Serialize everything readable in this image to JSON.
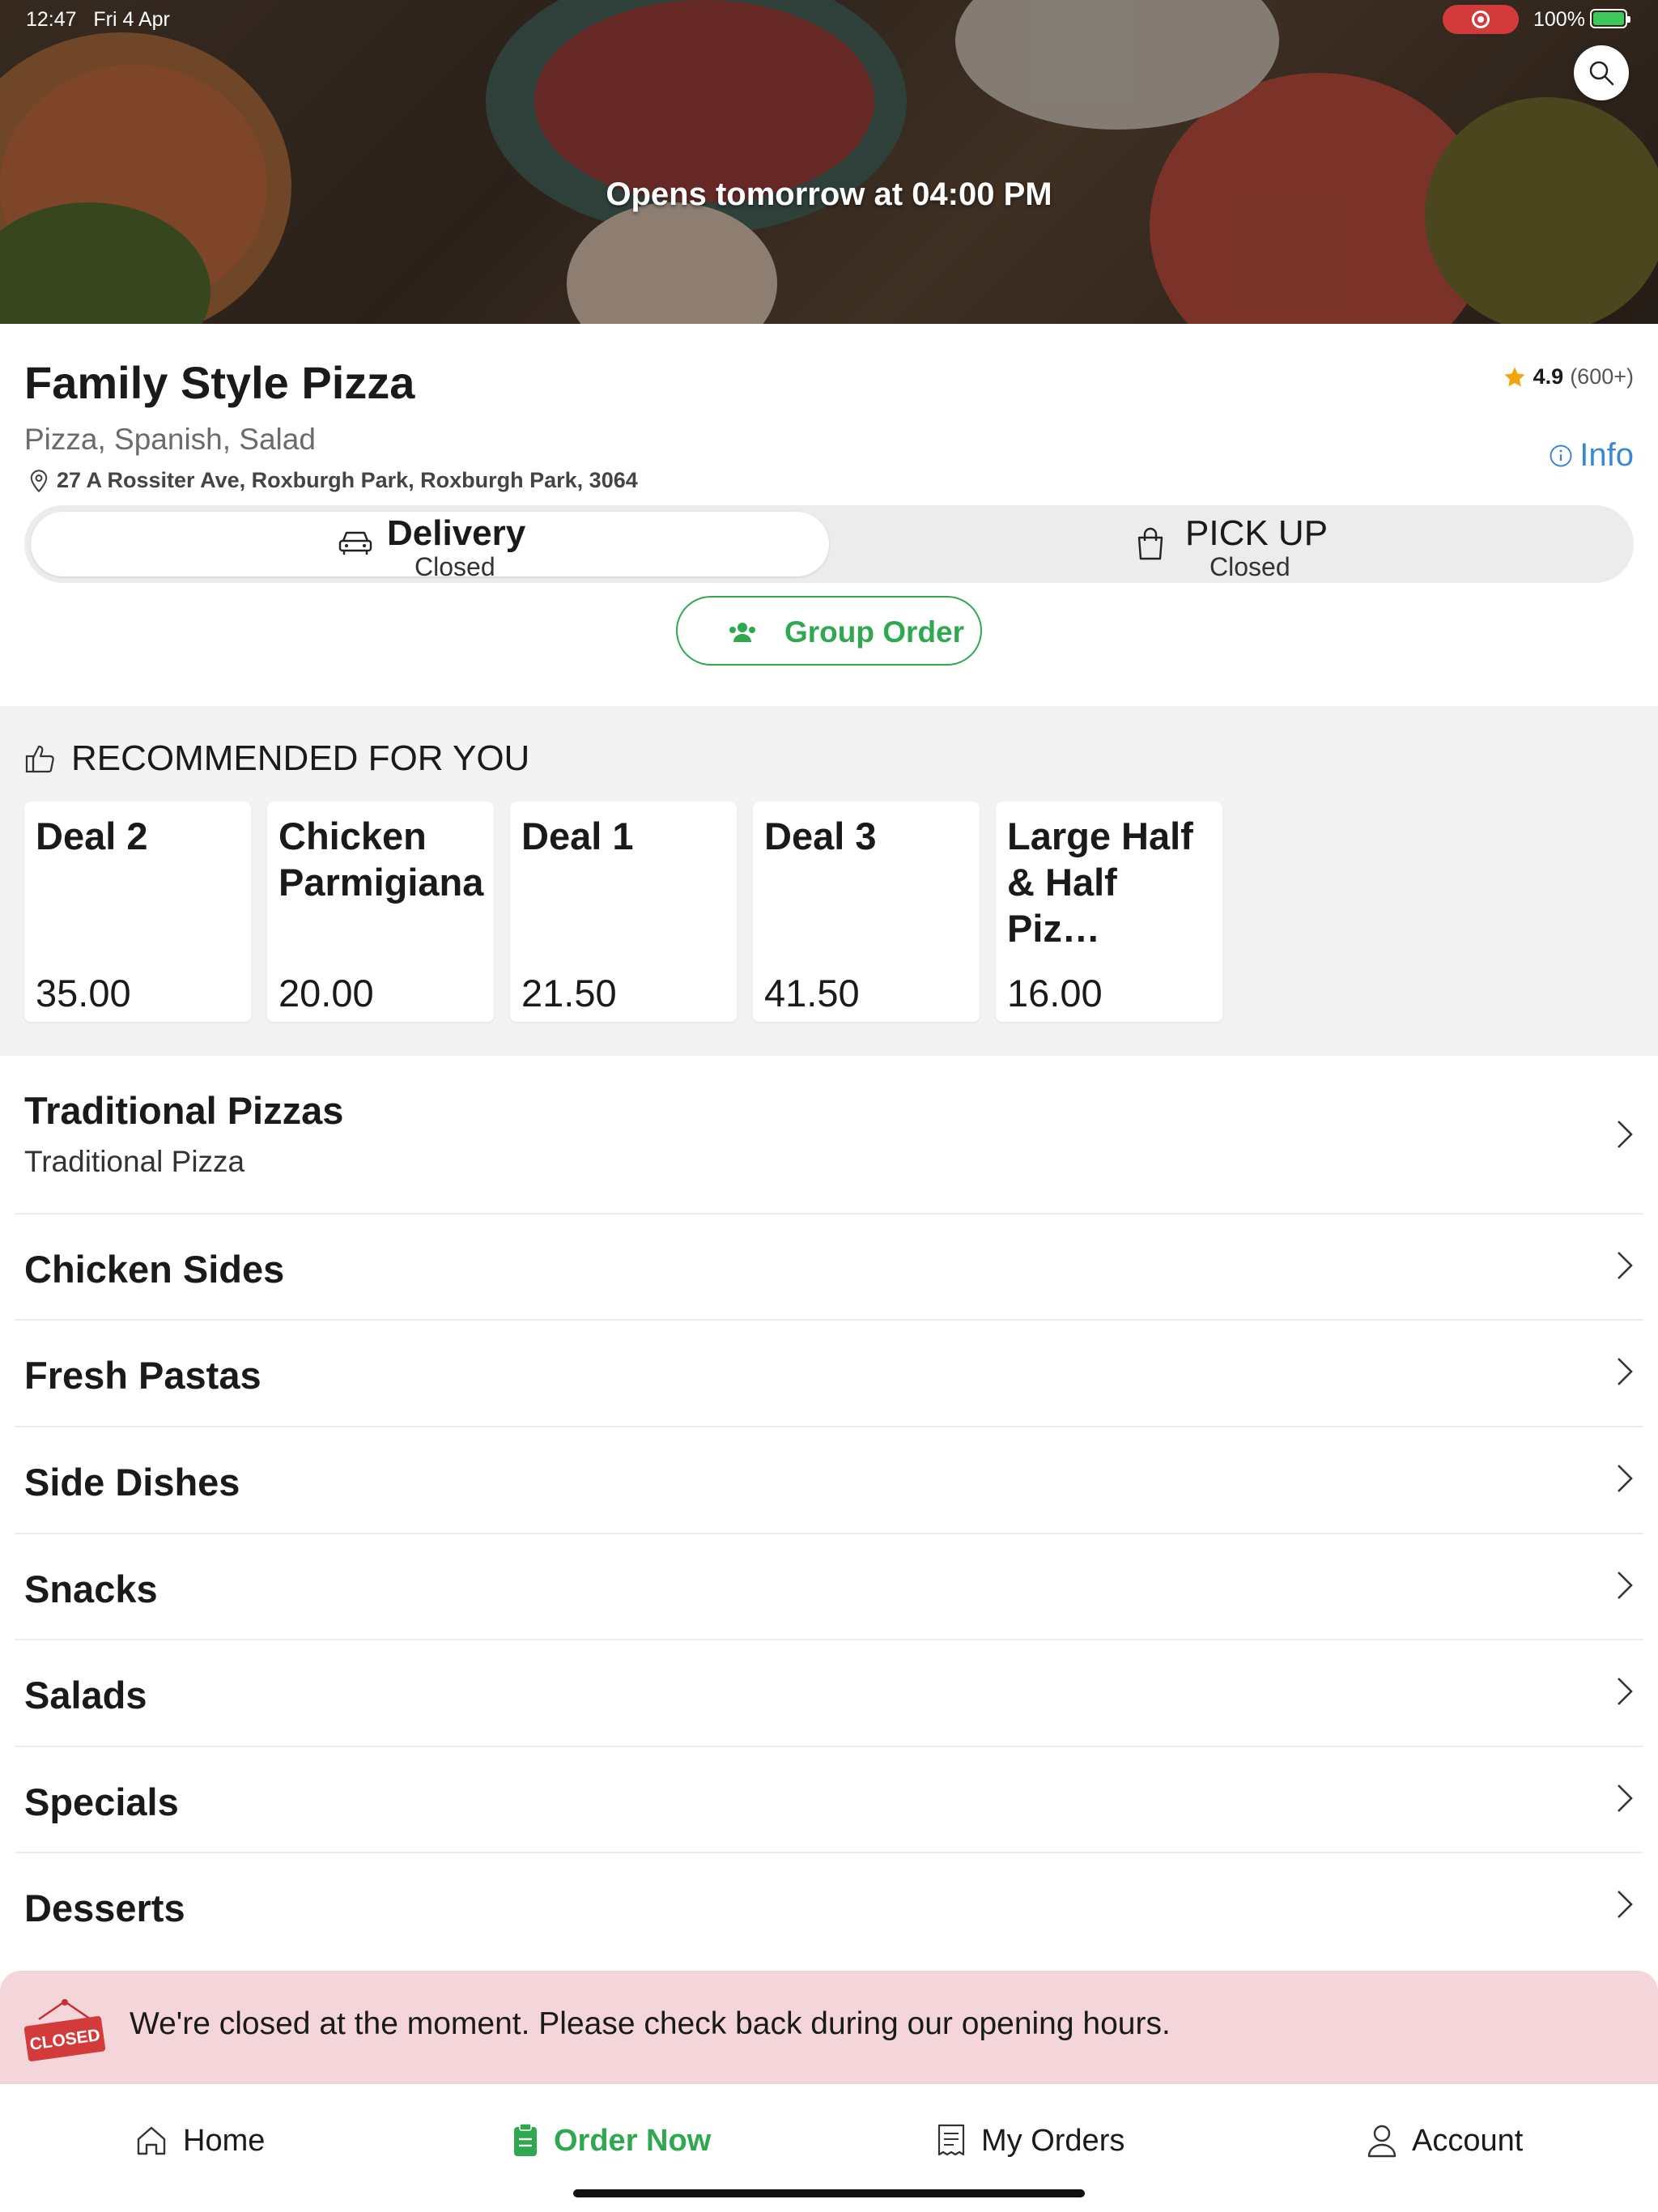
{
  "status_bar": {
    "time": "12:47",
    "date": "Fri 4 Apr",
    "battery": "100%"
  },
  "hero": {
    "opens_text": "Opens tomorrow at 04:00 PM"
  },
  "restaurant": {
    "name": "Family Style Pizza",
    "rating": "4.9",
    "rating_count": "(600+)",
    "cuisines": "Pizza, Spanish, Salad",
    "info_label": "Info",
    "address": "27 A Rossiter Ave, Roxburgh Park, Roxburgh Park, 3064"
  },
  "modes": {
    "delivery": {
      "label": "Delivery",
      "status": "Closed",
      "selected": true
    },
    "pickup": {
      "label": "PICK UP",
      "status": "Closed",
      "selected": false
    }
  },
  "group_order": {
    "label": "Group Order"
  },
  "recommended": {
    "title": "RECOMMENDED FOR YOU",
    "items": [
      {
        "name": "Deal 2",
        "price": "35.00"
      },
      {
        "name": "Chicken Parmigiana",
        "price": "20.00"
      },
      {
        "name": "Deal 1",
        "price": "21.50"
      },
      {
        "name": "Deal 3",
        "price": "41.50"
      },
      {
        "name": "Large Half & Half Piz…",
        "price": "16.00"
      }
    ]
  },
  "categories": [
    {
      "title": "Traditional Pizzas",
      "desc": "Traditional Pizza"
    },
    {
      "title": "Chicken Sides"
    },
    {
      "title": "Fresh Pastas"
    },
    {
      "title": "Side Dishes"
    },
    {
      "title": "Snacks"
    },
    {
      "title": "Salads"
    },
    {
      "title": "Specials"
    },
    {
      "title": "Desserts"
    }
  ],
  "closed_banner": {
    "badge": "CLOSED",
    "message": "We're closed at the moment. Please check back during our opening hours."
  },
  "tabbar": {
    "home": "Home",
    "order_now": "Order Now",
    "my_orders": "My Orders",
    "account": "Account"
  },
  "colors": {
    "accent_green": "#2fa84f",
    "info_blue": "#3a88d4",
    "closed_bg": "#f4d6da",
    "closed_badge": "#d33a3a",
    "star": "#f2a40c"
  }
}
